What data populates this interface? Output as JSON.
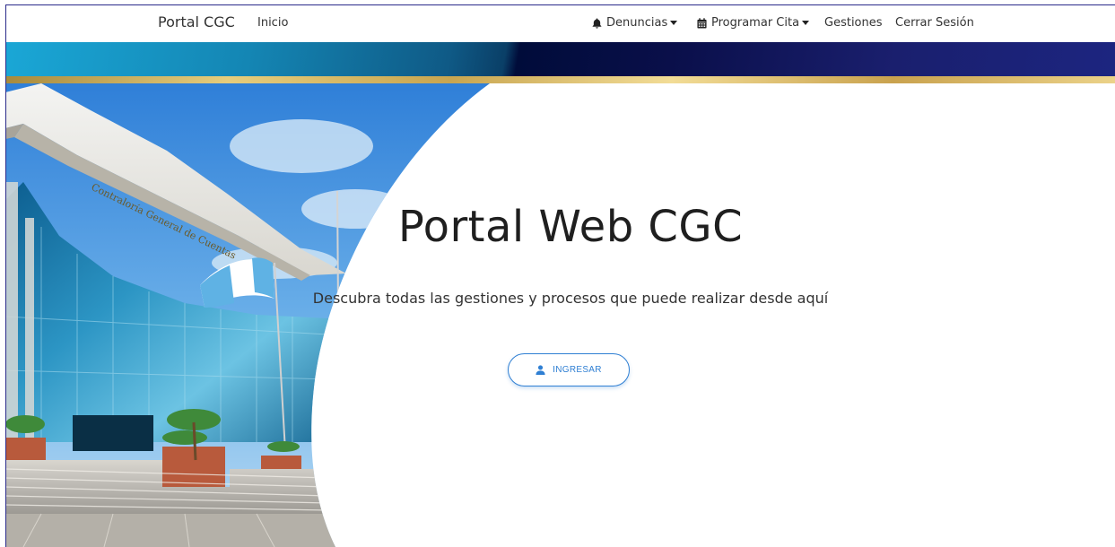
{
  "navbar": {
    "brand": "Portal CGC",
    "inicio": "Inicio",
    "denuncias": "Denuncias",
    "programar_cita": "Programar Cita",
    "gestiones": "Gestiones",
    "cerrar_sesion": "Cerrar Sesión",
    "icons": {
      "denuncias": "bell-icon",
      "programar_cita": "calendar-icon"
    }
  },
  "hero": {
    "title": "Portal Web CGC",
    "subtitle": "Descubra todas las gestiones y procesos que puede realizar desde aquí",
    "ingresar_label": "INGRESAR",
    "ingresar_icon": "user-icon",
    "building_sign": "Contraloría General de Cuentas"
  },
  "colors": {
    "accent": "#2f7fd3",
    "band_light": "#1aa7d6",
    "band_dark": "#000c3a",
    "gold": "#e6cd7c"
  }
}
